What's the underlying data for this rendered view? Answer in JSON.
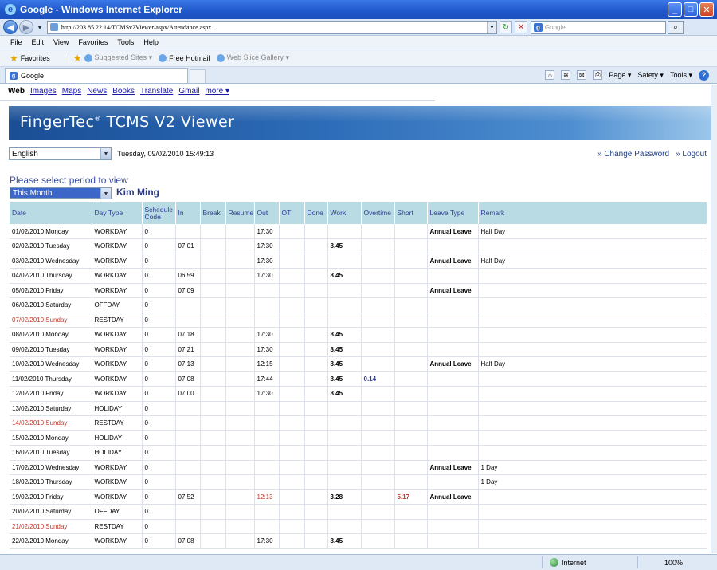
{
  "window": {
    "title": "Google - Windows Internet Explorer",
    "buttons": {
      "min": "_",
      "max": "□",
      "close": "✕"
    }
  },
  "nav": {
    "address": "http://203.85.22.14/TCMSv2Viewer/aspx/Attendance.aspx",
    "search_placeholder": "Google"
  },
  "menu": [
    "File",
    "Edit",
    "View",
    "Favorites",
    "Tools",
    "Help"
  ],
  "favorites": {
    "label": "Favorites",
    "suggested": "Suggested Sites ▾",
    "hotmail": "Free Hotmail",
    "webslice": "Web Slice Gallery ▾"
  },
  "tab": {
    "label": "Google"
  },
  "commandbar": {
    "page": "Page ▾",
    "safety": "Safety ▾",
    "tools": "Tools ▾",
    "help": "?"
  },
  "google_nav": {
    "active": "Web",
    "links": [
      "Images",
      "Maps",
      "News",
      "Books",
      "Translate",
      "Gmail",
      "more ▾"
    ]
  },
  "banner": {
    "title": "FingerTec",
    "reg": "®",
    "title_rest": " TCMS V2 Viewer"
  },
  "controls": {
    "language": "English",
    "datetime": "Tuesday, 09/02/2010 15:49:13",
    "change_password": "» Change Password",
    "logout": "» Logout",
    "period_label": "Please select period to view",
    "period_value": "This Month",
    "employee": "Kim Ming"
  },
  "table": {
    "headers": [
      "Date",
      "Day Type",
      "Schedule Code",
      "In",
      "Break",
      "Resume",
      "Out",
      "OT",
      "Done",
      "Work",
      "Overtime",
      "Short",
      "Leave Type",
      "Remark"
    ],
    "rows": [
      {
        "date": "01/02/2010 Monday",
        "day": "WORKDAY",
        "code": "0",
        "in": "",
        "brk": "",
        "res": "",
        "out": "17:30",
        "ot": "",
        "done": "",
        "work": "",
        "overtime": "",
        "short": "",
        "leave": "Annual Leave",
        "remark": "Half Day",
        "sunday": false
      },
      {
        "date": "02/02/2010 Tuesday",
        "day": "WORKDAY",
        "code": "0",
        "in": "07:01",
        "brk": "",
        "res": "",
        "out": "17:30",
        "ot": "",
        "done": "",
        "work": "8.45",
        "overtime": "",
        "short": "",
        "leave": "",
        "remark": "",
        "sunday": false
      },
      {
        "date": "03/02/2010 Wednesday",
        "day": "WORKDAY",
        "code": "0",
        "in": "",
        "brk": "",
        "res": "",
        "out": "17:30",
        "ot": "",
        "done": "",
        "work": "",
        "overtime": "",
        "short": "",
        "leave": "Annual Leave",
        "remark": "Half Day",
        "sunday": false
      },
      {
        "date": "04/02/2010 Thursday",
        "day": "WORKDAY",
        "code": "0",
        "in": "06:59",
        "brk": "",
        "res": "",
        "out": "17:30",
        "ot": "",
        "done": "",
        "work": "8.45",
        "overtime": "",
        "short": "",
        "leave": "",
        "remark": "",
        "sunday": false
      },
      {
        "date": "05/02/2010 Friday",
        "day": "WORKDAY",
        "code": "0",
        "in": "07:09",
        "brk": "",
        "res": "",
        "out": "",
        "ot": "",
        "done": "",
        "work": "",
        "overtime": "",
        "short": "",
        "leave": "Annual Leave",
        "remark": "",
        "sunday": false
      },
      {
        "date": "06/02/2010 Saturday",
        "day": "OFFDAY",
        "code": "0",
        "in": "",
        "brk": "",
        "res": "",
        "out": "",
        "ot": "",
        "done": "",
        "work": "",
        "overtime": "",
        "short": "",
        "leave": "",
        "remark": "",
        "sunday": false
      },
      {
        "date": "07/02/2010 Sunday",
        "day": "RESTDAY",
        "code": "0",
        "in": "",
        "brk": "",
        "res": "",
        "out": "",
        "ot": "",
        "done": "",
        "work": "",
        "overtime": "",
        "short": "",
        "leave": "",
        "remark": "",
        "sunday": true
      },
      {
        "date": "08/02/2010 Monday",
        "day": "WORKDAY",
        "code": "0",
        "in": "07:18",
        "brk": "",
        "res": "",
        "out": "17:30",
        "ot": "",
        "done": "",
        "work": "8.45",
        "overtime": "",
        "short": "",
        "leave": "",
        "remark": "",
        "sunday": false
      },
      {
        "date": "09/02/2010 Tuesday",
        "day": "WORKDAY",
        "code": "0",
        "in": "07:21",
        "brk": "",
        "res": "",
        "out": "17:30",
        "ot": "",
        "done": "",
        "work": "8.45",
        "overtime": "",
        "short": "",
        "leave": "",
        "remark": "",
        "sunday": false
      },
      {
        "date": "10/02/2010 Wednesday",
        "day": "WORKDAY",
        "code": "0",
        "in": "07:13",
        "brk": "",
        "res": "",
        "out": "12:15",
        "ot": "",
        "done": "",
        "work": "8.45",
        "overtime": "",
        "short": "",
        "leave": "Annual Leave",
        "remark": "Half Day",
        "sunday": false
      },
      {
        "date": "11/02/2010 Thursday",
        "day": "WORKDAY",
        "code": "0",
        "in": "07:08",
        "brk": "",
        "res": "",
        "out": "17:44",
        "ot": "",
        "done": "",
        "work": "8.45",
        "overtime": "0.14",
        "short": "",
        "leave": "",
        "remark": "",
        "sunday": false
      },
      {
        "date": "12/02/2010 Friday",
        "day": "WORKDAY",
        "code": "0",
        "in": "07:00",
        "brk": "",
        "res": "",
        "out": "17:30",
        "ot": "",
        "done": "",
        "work": "8.45",
        "overtime": "",
        "short": "",
        "leave": "",
        "remark": "",
        "sunday": false
      },
      {
        "date": "13/02/2010 Saturday",
        "day": "HOLIDAY",
        "code": "0",
        "in": "",
        "brk": "",
        "res": "",
        "out": "",
        "ot": "",
        "done": "",
        "work": "",
        "overtime": "",
        "short": "",
        "leave": "",
        "remark": "",
        "sunday": false
      },
      {
        "date": "14/02/2010 Sunday",
        "day": "RESTDAY",
        "code": "0",
        "in": "",
        "brk": "",
        "res": "",
        "out": "",
        "ot": "",
        "done": "",
        "work": "",
        "overtime": "",
        "short": "",
        "leave": "",
        "remark": "",
        "sunday": true
      },
      {
        "date": "15/02/2010 Monday",
        "day": "HOLIDAY",
        "code": "0",
        "in": "",
        "brk": "",
        "res": "",
        "out": "",
        "ot": "",
        "done": "",
        "work": "",
        "overtime": "",
        "short": "",
        "leave": "",
        "remark": "",
        "sunday": false
      },
      {
        "date": "16/02/2010 Tuesday",
        "day": "HOLIDAY",
        "code": "0",
        "in": "",
        "brk": "",
        "res": "",
        "out": "",
        "ot": "",
        "done": "",
        "work": "",
        "overtime": "",
        "short": "",
        "leave": "",
        "remark": "",
        "sunday": false
      },
      {
        "date": "17/02/2010 Wednesday",
        "day": "WORKDAY",
        "code": "0",
        "in": "",
        "brk": "",
        "res": "",
        "out": "",
        "ot": "",
        "done": "",
        "work": "",
        "overtime": "",
        "short": "",
        "leave": "Annual Leave",
        "remark": "1 Day",
        "sunday": false
      },
      {
        "date": "18/02/2010 Thursday",
        "day": "WORKDAY",
        "code": "0",
        "in": "",
        "brk": "",
        "res": "",
        "out": "",
        "ot": "",
        "done": "",
        "work": "",
        "overtime": "",
        "short": "",
        "leave": "",
        "remark": "1 Day",
        "sunday": false
      },
      {
        "date": "19/02/2010 Friday",
        "day": "WORKDAY",
        "code": "0",
        "in": "07:52",
        "brk": "",
        "res": "",
        "out": "12:13",
        "ot": "",
        "done": "",
        "work": "3.28",
        "overtime": "",
        "short": "5.17",
        "leave": "Annual Leave",
        "remark": "",
        "sunday": false,
        "out_red": true
      },
      {
        "date": "20/02/2010 Saturday",
        "day": "OFFDAY",
        "code": "0",
        "in": "",
        "brk": "",
        "res": "",
        "out": "",
        "ot": "",
        "done": "",
        "work": "",
        "overtime": "",
        "short": "",
        "leave": "",
        "remark": "",
        "sunday": false
      },
      {
        "date": "21/02/2010 Sunday",
        "day": "RESTDAY",
        "code": "0",
        "in": "",
        "brk": "",
        "res": "",
        "out": "",
        "ot": "",
        "done": "",
        "work": "",
        "overtime": "",
        "short": "",
        "leave": "",
        "remark": "",
        "sunday": true
      },
      {
        "date": "22/02/2010 Monday",
        "day": "WORKDAY",
        "code": "0",
        "in": "07:08",
        "brk": "",
        "res": "",
        "out": "17:30",
        "ot": "",
        "done": "",
        "work": "8.45",
        "overtime": "",
        "short": "",
        "leave": "",
        "remark": "",
        "sunday": false
      }
    ]
  },
  "status": {
    "zone": "Internet",
    "zoom": "100%"
  },
  "colors": {
    "header_bg": "#b8dbe4",
    "header_text": "#2f3e90",
    "sunday_red": "#c0392b"
  }
}
